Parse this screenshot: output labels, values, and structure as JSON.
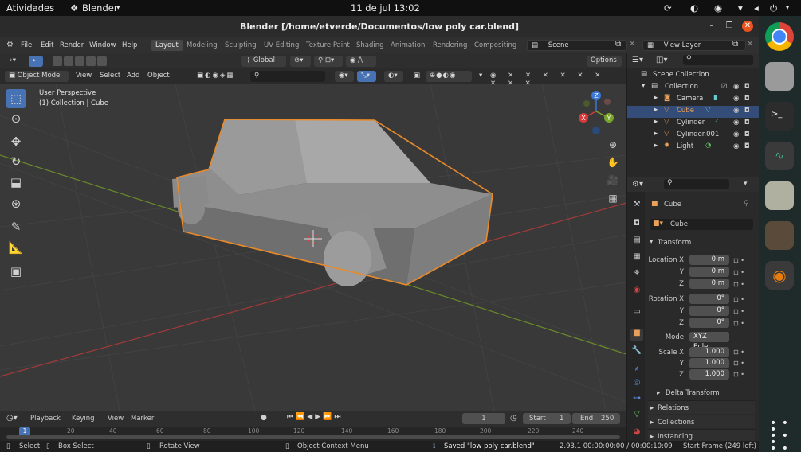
{
  "gnome": {
    "activities": "Atividades",
    "app": "Blender",
    "datetime": "11 de jul  13:02"
  },
  "window": {
    "title": "Blender [/home/etverde/Documentos/low poly car.blend]"
  },
  "menu": {
    "items": [
      "File",
      "Edit",
      "Render",
      "Window",
      "Help"
    ]
  },
  "workspaces": [
    "Layout",
    "Modeling",
    "Sculpting",
    "UV Editing",
    "Texture Paint",
    "Shading",
    "Animation",
    "Rendering",
    "Compositing"
  ],
  "scene": {
    "name": "Scene",
    "view_layer": "View Layer"
  },
  "viewport": {
    "transform": "Global",
    "options": "Options",
    "mode": "Object Mode",
    "menus": [
      "View",
      "Select",
      "Add",
      "Object"
    ],
    "perspective": "User Perspective",
    "collection_label": "(1) Collection | Cube",
    "axes": {
      "x": "X",
      "y": "Y",
      "z": "Z"
    }
  },
  "outliner": {
    "root": "Scene Collection",
    "collection": "Collection",
    "items": [
      "Camera",
      "Cube",
      "Cylinder",
      "Cylinder.001",
      "Light"
    ]
  },
  "properties": {
    "object_name": "Cube",
    "data_name": "Cube",
    "transform": "Transform",
    "loc_label": "Location X",
    "loc": [
      "0 m",
      "0 m",
      "0 m"
    ],
    "rot_label": "Rotation X",
    "rot": [
      "0°",
      "0°",
      "0°"
    ],
    "mode_label": "Mode",
    "mode": "XYZ Euler",
    "scale_label": "Scale X",
    "scale": [
      "1.000",
      "1.000",
      "1.000"
    ],
    "y": "Y",
    "z": "Z",
    "delta": "Delta Transform",
    "sections": [
      "Relations",
      "Collections",
      "Instancing"
    ]
  },
  "timeline": {
    "menus": [
      "Playback",
      "Keying",
      "View",
      "Marker"
    ],
    "current": "1",
    "start_label": "Start",
    "start": "1",
    "end_label": "End",
    "end": "250",
    "ticks": [
      "1",
      "20",
      "40",
      "60",
      "80",
      "100",
      "120",
      "140",
      "160",
      "180",
      "200",
      "220",
      "240"
    ]
  },
  "status": {
    "select": "Select",
    "box": "Box Select",
    "rotate": "Rotate View",
    "context": "Object Context Menu",
    "saved": "Saved \"low poly car.blend\"",
    "info": "2.93.1  00:00:00:00 / 00:00:10:09",
    "frame": "Start Frame (249 left)"
  },
  "colors": {
    "accent": "#e88a2b",
    "selected": "#344c78",
    "ui_bg": "#303030"
  }
}
